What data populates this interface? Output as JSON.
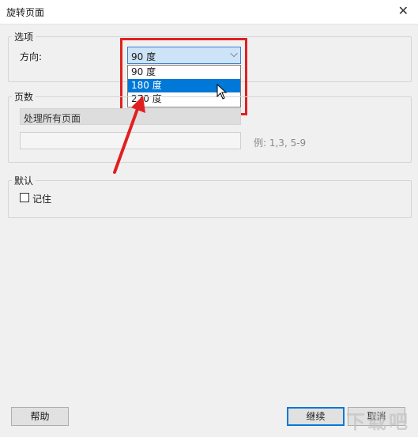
{
  "window": {
    "title": "旋转页面",
    "close_glyph": "✕"
  },
  "options": {
    "legend": "选项",
    "direction_label": "方向:",
    "selected": "90 度",
    "dropdown_items": [
      "90 度",
      "180 度",
      "270 度"
    ],
    "highlighted_index": 1
  },
  "pages": {
    "legend": "页数",
    "range_select": "处理所有页面",
    "range_input_value": "",
    "hint": "例: 1,3, 5-9"
  },
  "defaults": {
    "legend": "默认",
    "remember_label": "记住",
    "remember_checked": false
  },
  "buttons": {
    "help": "帮助",
    "continue": "继续",
    "cancel": "取消"
  },
  "watermark": {
    "text": "下载吧"
  },
  "icons": {
    "close": "close-icon",
    "chevron": "chevron-down-icon",
    "cursor": "mouse-cursor-icon",
    "annotation": "red-arrow-annotation"
  },
  "colors": {
    "selection": "#0078d7",
    "annotation": "#e02020",
    "field_focus": "#cde3f7"
  }
}
